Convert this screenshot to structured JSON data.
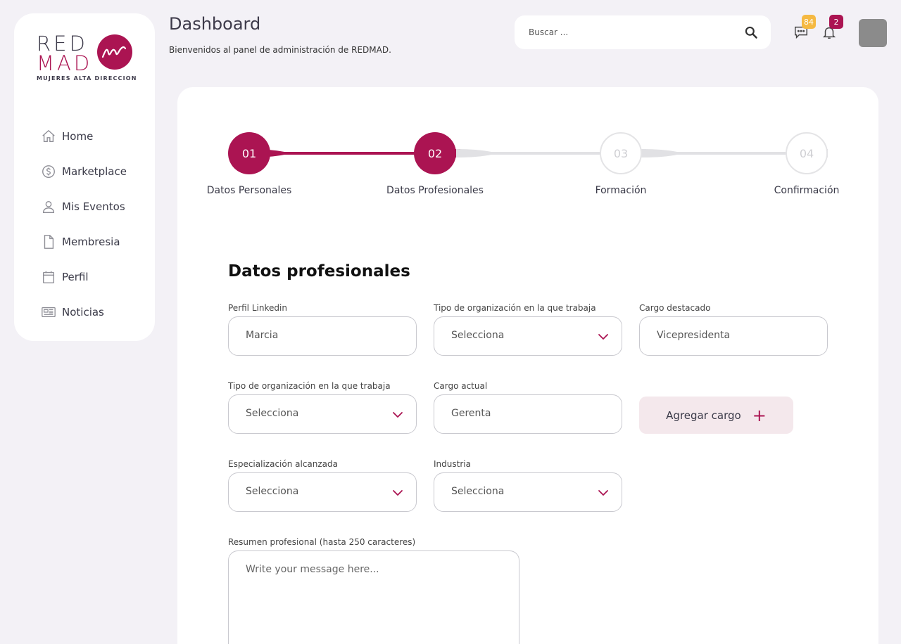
{
  "colors": {
    "brand": "#ab1452",
    "badge_messages": "#f5b942",
    "badge_alerts": "#ab1452"
  },
  "logo": {
    "line1": "RED",
    "line2": "MAD",
    "tagline": "MUJERES ALTA DIRECCION"
  },
  "sidebar": {
    "items": [
      {
        "label": "Home",
        "icon": "home-icon"
      },
      {
        "label": "Marketplace",
        "icon": "dollar-circle-icon"
      },
      {
        "label": "Mis Eventos",
        "icon": "user-icon"
      },
      {
        "label": "Membresia",
        "icon": "document-icon"
      },
      {
        "label": "Perfil",
        "icon": "calendar-icon"
      },
      {
        "label": "Noticias",
        "icon": "newspaper-icon"
      }
    ]
  },
  "header": {
    "title": "Dashboard",
    "subtitle": "Bienvenidos al panel de administración de REDMAD.",
    "search_placeholder": "Buscar ...",
    "messages_count": "84",
    "alerts_count": "2"
  },
  "stepper": {
    "steps": [
      {
        "number": "01",
        "label": "Datos Personales",
        "state": "active"
      },
      {
        "number": "02",
        "label": "Datos Profesionales",
        "state": "active"
      },
      {
        "number": "03",
        "label": "Formación",
        "state": "idle"
      },
      {
        "number": "04",
        "label": "Confirmación",
        "state": "idle"
      }
    ]
  },
  "form": {
    "title": "Datos profesionales",
    "linkedin": {
      "label": "Perfil Linkedin",
      "value": "Marcia"
    },
    "org_type_1": {
      "label": "Tipo de organización en la que trabaja",
      "value": "Selecciona"
    },
    "cargo_destacado": {
      "label": "Cargo destacado",
      "value": "Vicepresidenta"
    },
    "org_type_2": {
      "label": "Tipo de organización en la que trabaja",
      "value": "Selecciona"
    },
    "cargo_actual": {
      "label": "Cargo actual",
      "value": "Gerenta"
    },
    "add_cargo_label": "Agregar cargo",
    "add_cargo_plus": "+",
    "especializacion": {
      "label": "Especialización alcanzada",
      "value": "Selecciona"
    },
    "industria": {
      "label": "Industria",
      "value": "Selecciona"
    },
    "resumen": {
      "label": "Resumen profesional (hasta 250 caracteres)",
      "placeholder": "Write your message here..."
    }
  }
}
